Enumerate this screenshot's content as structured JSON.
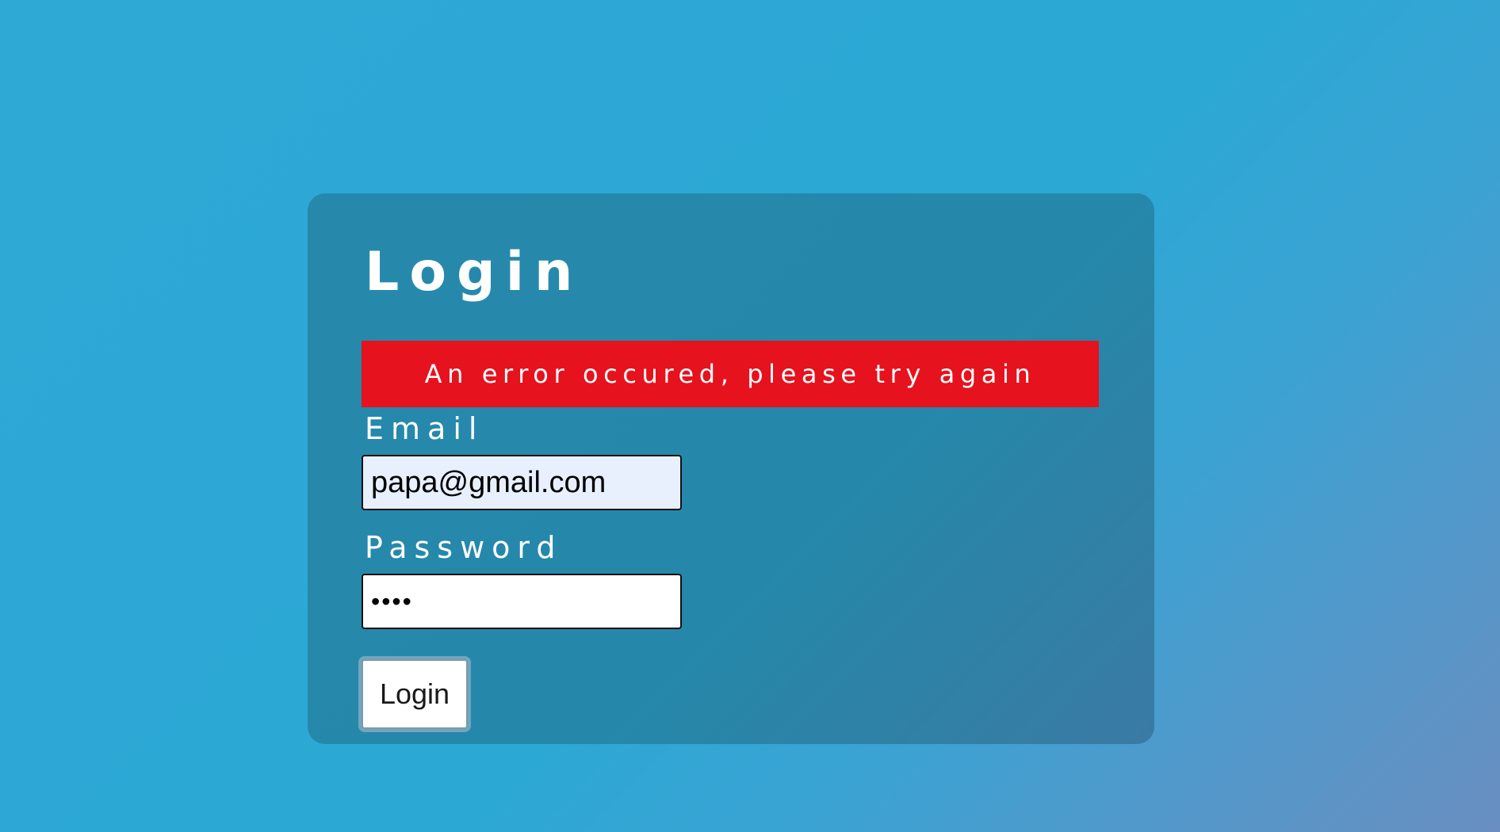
{
  "login_form": {
    "title": "Login",
    "error_message": "An error occured, please try again",
    "email": {
      "label": "Email",
      "value": "papa@gmail.com"
    },
    "password": {
      "label": "Password",
      "value": "••••"
    },
    "submit_label": "Login"
  },
  "colors": {
    "background": "#2ca8d5",
    "card": "#2588aa",
    "error": "#e6121e",
    "email_autofill": "#e8f0fe"
  }
}
